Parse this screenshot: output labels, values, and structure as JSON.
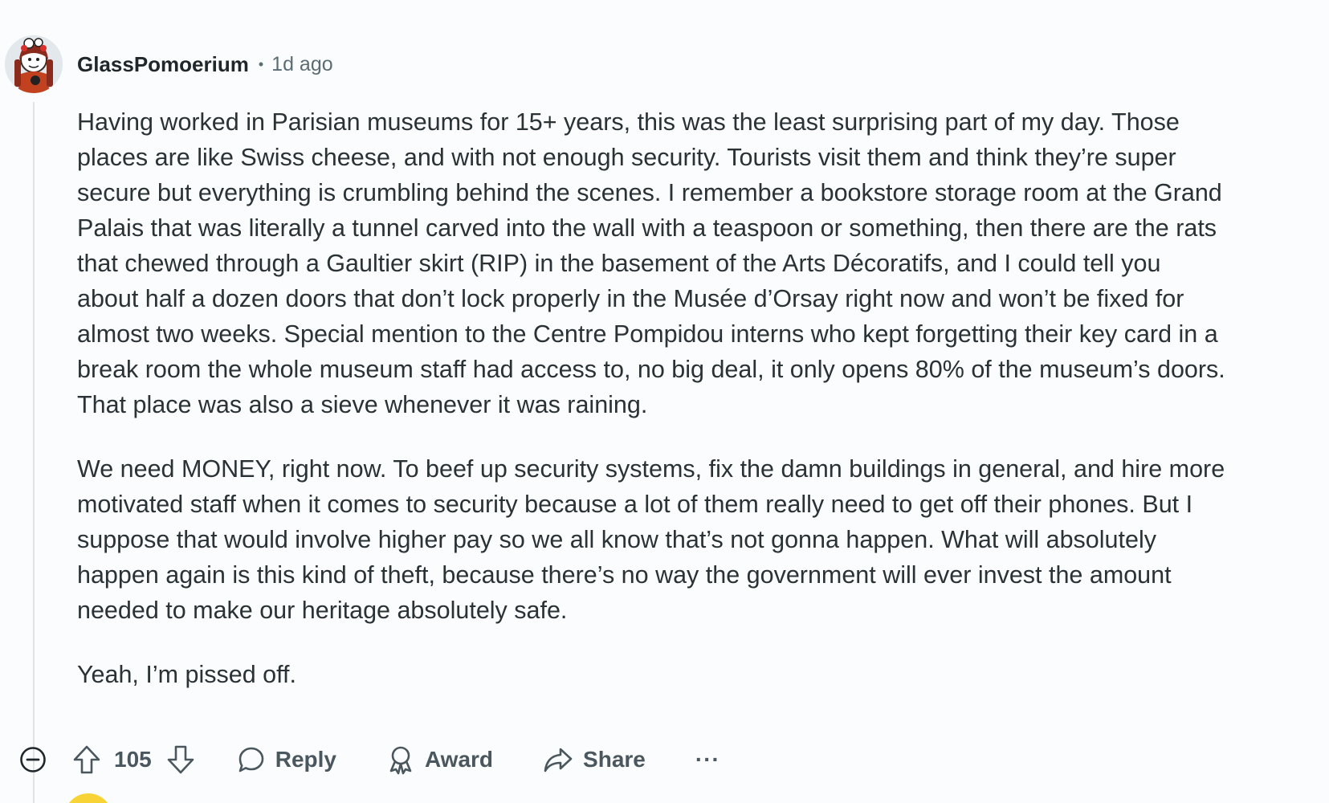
{
  "comment": {
    "username": "GlassPomoerium",
    "separator": "•",
    "timestamp": "1d ago",
    "paragraphs": [
      "Having worked in Parisian museums for 15+ years, this was the least surprising part of my day. Those places are like Swiss cheese, and with not enough security. Tourists visit them and think they’re super secure but everything is crumbling behind the scenes. I remember a bookstore storage room at the Grand Palais that was literally a tunnel carved into the wall with a teaspoon or something, then there are the rats that chewed through a Gaultier skirt (RIP) in the basement of the Arts Décoratifs, and I could tell you about half a dozen doors that don’t lock properly in the Musée d’Orsay right now and won’t be fixed for almost two weeks. Special mention to the Centre Pompidou interns who kept forgetting their key card in a break room the whole museum staff had access to, no big deal, it only opens 80% of the museum’s doors. That place was also a sieve whenever it was raining.",
      "We need MONEY, right now. To beef up security systems, fix the damn buildings in general, and hire more motivated staff when it comes to security because a lot of them really need to get off their phones. But I suppose that would involve higher pay so we all know that’s not gonna happen. What will absolutely happen again is this kind of theft, because there’s no way the government will ever invest the amount needed to make our heritage absolutely safe.",
      "Yeah, I’m pissed off."
    ]
  },
  "actions": {
    "score": "105",
    "reply_label": "Reply",
    "award_label": "Award",
    "share_label": "Share",
    "more_label": "···"
  },
  "icons": {
    "collapse": "minus-circle-icon",
    "upvote": "arrow-up-icon",
    "downvote": "arrow-down-icon",
    "reply": "speech-bubble-icon",
    "award": "award-ribbon-icon",
    "share": "share-arrow-icon"
  },
  "colors": {
    "background": "#fbfcfd",
    "text": "#2a3236",
    "muted": "#5c6c74",
    "thread_line": "#dfe3e6",
    "next_avatar": "#f8d336"
  }
}
